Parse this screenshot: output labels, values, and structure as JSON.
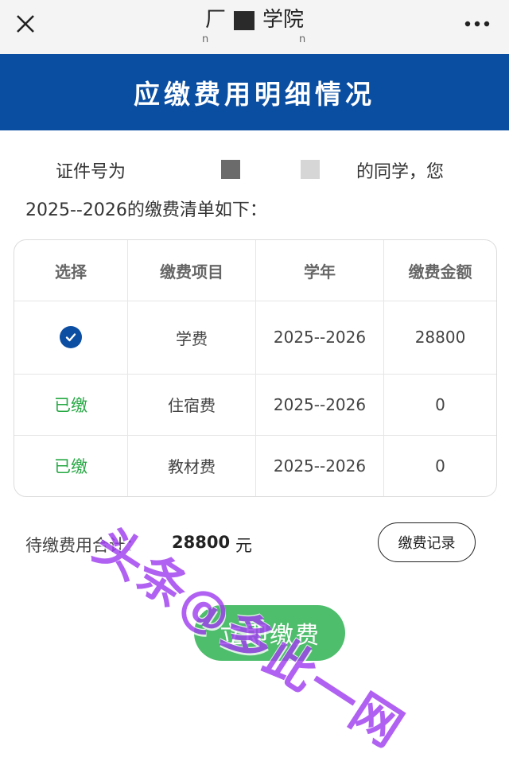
{
  "topbar": {
    "title_prefix": "厂",
    "title_suffix": "学院",
    "subtitle_left": "n",
    "subtitle_right": "n",
    "close_icon": "close-icon",
    "more_icon": "more-icon"
  },
  "banner": {
    "title": "应缴费用明细情况"
  },
  "intro": {
    "line1_a": "证件号为",
    "line1_b": "的同学，您",
    "line2": "2025--2026的缴费清单如下："
  },
  "table": {
    "headers": [
      "选择",
      "缴费项目",
      "学年",
      "缴费金额"
    ],
    "rows": [
      {
        "select_icon": "check-circle-icon",
        "item": "学费",
        "year": "2025--2026",
        "amount": "28800"
      },
      {
        "status": "已缴",
        "item": "住宿费",
        "year": "2025--2026",
        "amount": "0"
      },
      {
        "status": "已缴",
        "item": "教材费",
        "year": "2025--2026",
        "amount": "0"
      }
    ]
  },
  "summary": {
    "label": "待缴费用合计：",
    "amount": "28800",
    "unit": "元",
    "record_button": "缴费记录"
  },
  "actions": {
    "pay_button": "立即缴费"
  },
  "watermark": "头条@多此一网",
  "colors": {
    "banner": "#0a4ea2",
    "paid_green": "#27a845",
    "pay_button": "#4ebd6c",
    "watermark": "#a03ff0"
  }
}
